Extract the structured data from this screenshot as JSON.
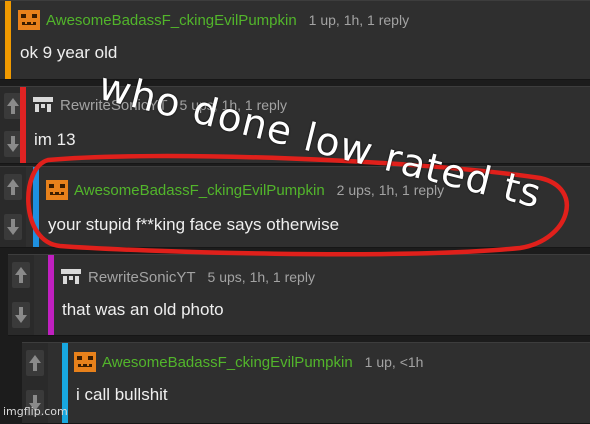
{
  "comments": [
    {
      "user": "AwesomeBadassF_ckingEvilPumpkin",
      "meta": "1 up, 1h, 1 reply",
      "body": "ok 9 year old",
      "bar_color": "#f09a00",
      "user_color": "#52b52b",
      "avatar": "pumpkin-avatar"
    },
    {
      "user": "RewriteSonicYT",
      "meta": "5 ups, 1h, 1 reply",
      "body": "im 13",
      "bar_color": "#e02323",
      "user_color": "#a3a3a3",
      "avatar": "pixel-face-avatar"
    },
    {
      "user": "AwesomeBadassF_ckingEvilPumpkin",
      "meta": "2 ups, 1h, 1 reply",
      "body": "your stupid f**king face says otherwise",
      "bar_color": "#1e90e0",
      "user_color": "#52b52b",
      "avatar": "pumpkin-avatar"
    },
    {
      "user": "RewriteSonicYT",
      "meta": "5 ups, 1h, 1 reply",
      "body": "that was an old photo",
      "bar_color": "#c020c0",
      "user_color": "#a3a3a3",
      "avatar": "pixel-face-avatar"
    },
    {
      "user": "AwesomeBadassF_ckingEvilPumpkin",
      "meta": "1 up, <1h",
      "body": "i call bullshit",
      "bar_color": "#18a8e0",
      "user_color": "#52b52b",
      "avatar": "pumpkin-avatar"
    }
  ],
  "vote_icons": {
    "up": "arrow-up-icon",
    "down": "arrow-down-icon"
  },
  "overlay": {
    "caption": "who done low rated ts",
    "circle_color": "#e0201b"
  },
  "watermark": "imgflip.com"
}
